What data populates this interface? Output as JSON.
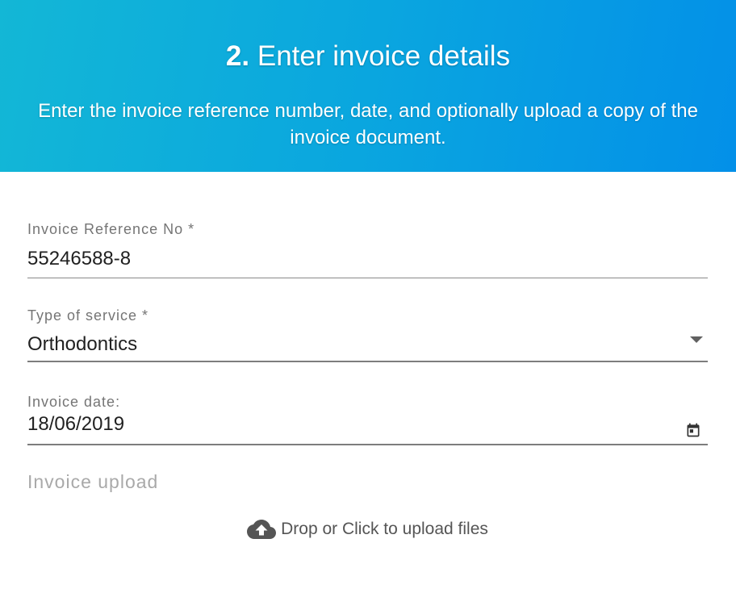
{
  "header": {
    "step_number": "2.",
    "title": "Enter invoice details",
    "subtitle": "Enter the invoice reference number, date, and optionally upload a copy of the invoice document.",
    "gradient_start": "#13b7d6",
    "gradient_end": "#0390e8"
  },
  "form": {
    "invoice_reference": {
      "label": "Invoice Reference No *",
      "value": "55246588-8"
    },
    "service_type": {
      "label": "Type of service *",
      "value": "Orthodontics",
      "icon": "dropdown-arrow-icon"
    },
    "invoice_date": {
      "label": "Invoice date:",
      "value": "18/06/2019",
      "icon": "calendar-icon"
    },
    "invoice_upload": {
      "label": "Invoice upload",
      "prompt": "Drop or Click to upload files",
      "icon": "cloud-upload-icon"
    }
  }
}
